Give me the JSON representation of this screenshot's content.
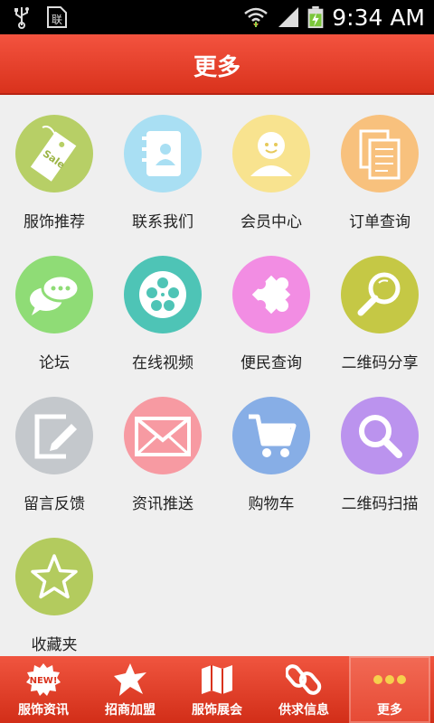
{
  "status_bar": {
    "time": "9:34 AM"
  },
  "header": {
    "title": "更多"
  },
  "grid": {
    "items": [
      {
        "label": "服饰推荐",
        "icon": "sale-tag-icon",
        "color": "#b7cf66"
      },
      {
        "label": "联系我们",
        "icon": "contacts-book-icon",
        "color": "#a9dff3"
      },
      {
        "label": "会员中心",
        "icon": "member-user-icon",
        "color": "#f8e38f"
      },
      {
        "label": "订单查询",
        "icon": "order-documents-icon",
        "color": "#f8c17d"
      },
      {
        "label": "论坛",
        "icon": "chat-bubbles-icon",
        "color": "#8fdc76"
      },
      {
        "label": "在线视频",
        "icon": "film-reel-icon",
        "color": "#4ec4b6"
      },
      {
        "label": "便民查询",
        "icon": "puzzle-icon",
        "color": "#f28de3"
      },
      {
        "label": "二维码分享",
        "icon": "magnifier-icon",
        "color": "#c5c845"
      },
      {
        "label": "留言反馈",
        "icon": "edit-note-icon",
        "color": "#c4c8cc"
      },
      {
        "label": "资讯推送",
        "icon": "envelope-icon",
        "color": "#f79aa2"
      },
      {
        "label": "购物车",
        "icon": "shopping-cart-icon",
        "color": "#87aee6"
      },
      {
        "label": "二维码扫描",
        "icon": "search-icon",
        "color": "#bb93ee"
      },
      {
        "label": "收藏夹",
        "icon": "star-icon",
        "color": "#b3cb5e"
      }
    ]
  },
  "tabbar": {
    "tabs": [
      {
        "label": "服饰资讯",
        "icon": "new-badge-icon",
        "badge_text": "NEW!"
      },
      {
        "label": "招商加盟",
        "icon": "starburst-icon"
      },
      {
        "label": "服饰展会",
        "icon": "map-icon"
      },
      {
        "label": "供求信息",
        "icon": "chain-link-icon"
      },
      {
        "label": "更多",
        "icon": "more-dots-icon",
        "active": true
      }
    ]
  }
}
